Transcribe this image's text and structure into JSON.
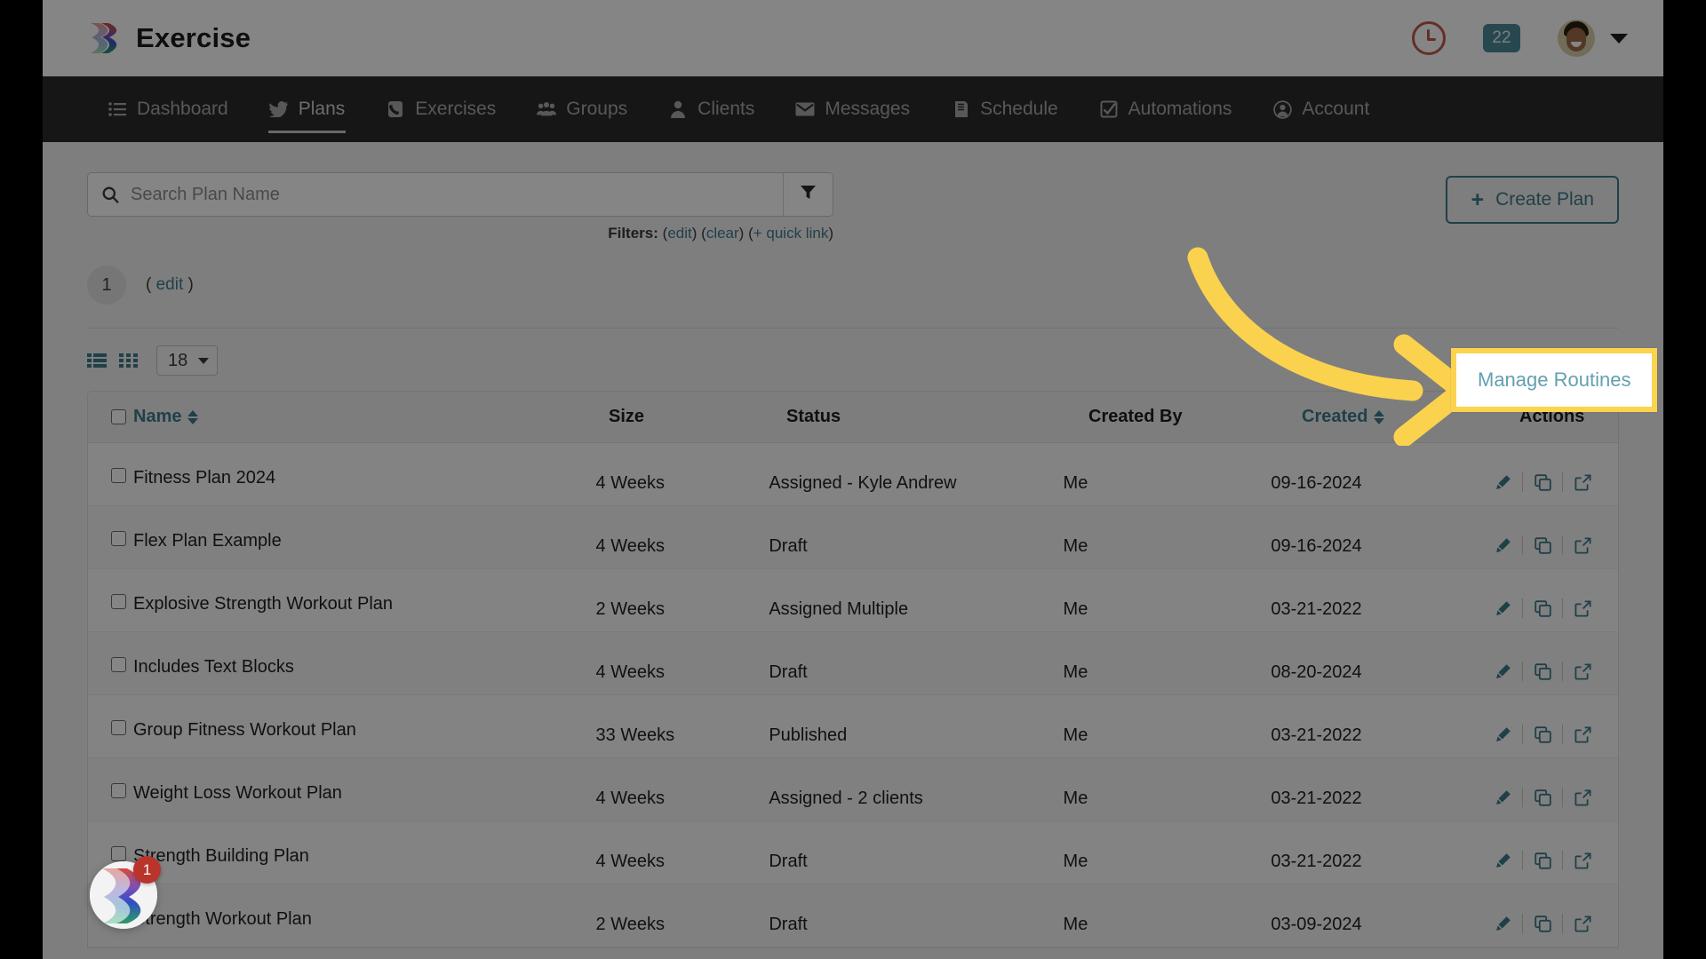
{
  "header": {
    "brand_name": "Exercise",
    "logo_icon": "exercise-waves-logo",
    "clock_icon": "clock-icon",
    "notification_count": "22",
    "avatar_icon": "user-avatar",
    "chevron_icon": "chevron-down-icon"
  },
  "nav": {
    "items": [
      {
        "label": "Dashboard",
        "icon": "list-icon",
        "active": false
      },
      {
        "label": "Plans",
        "icon": "bird-icon",
        "active": true
      },
      {
        "label": "Exercises",
        "icon": "phone-icon",
        "active": false
      },
      {
        "label": "Groups",
        "icon": "people-icon",
        "active": false
      },
      {
        "label": "Clients",
        "icon": "person-icon",
        "active": false
      },
      {
        "label": "Messages",
        "icon": "envelope-icon",
        "active": false
      },
      {
        "label": "Schedule",
        "icon": "book-icon",
        "active": false
      },
      {
        "label": "Automations",
        "icon": "check-square-icon",
        "active": false
      },
      {
        "label": "Account",
        "icon": "user-circle-icon",
        "active": false
      }
    ]
  },
  "toolbar": {
    "search_placeholder": "Search Plan Name",
    "search_value": "",
    "search_icon": "search-icon",
    "filter_icon": "funnel-icon",
    "create_plan_label": "Create Plan",
    "create_plan_plus": "+",
    "filters_label": "Filters:",
    "filters_edit": "edit",
    "filters_clear": "clear",
    "filters_quick_link": "+ quick link",
    "paren_open": "(",
    "paren_close": ")"
  },
  "page_count": {
    "value": "1",
    "edit_label": "edit",
    "edit_prefix": "( ",
    "edit_suffix": " )"
  },
  "view_controls": {
    "list_view_icon": "list-view-icon",
    "grid_view_icon": "grid-view-icon",
    "per_page_value": "18",
    "manage_routines_label": "Manage Routines"
  },
  "table": {
    "columns": [
      {
        "key": "name",
        "label": "Name",
        "sortable": true
      },
      {
        "key": "size",
        "label": "Size",
        "sortable": false
      },
      {
        "key": "status",
        "label": "Status",
        "sortable": false
      },
      {
        "key": "by",
        "label": "Created By",
        "sortable": false
      },
      {
        "key": "created",
        "label": "Created",
        "sortable": true
      },
      {
        "key": "actions",
        "label": "Actions",
        "sortable": false
      }
    ],
    "action_icons": [
      "pencil-icon",
      "copy-icon",
      "external-link-icon"
    ],
    "rows": [
      {
        "name": "Fitness Plan 2024",
        "size": "4 Weeks",
        "status": "Assigned - Kyle Andrew",
        "by": "Me",
        "created": "09-16-2024"
      },
      {
        "name": "Flex Plan Example",
        "size": "4 Weeks",
        "status": "Draft",
        "by": "Me",
        "created": "09-16-2024"
      },
      {
        "name": "Explosive Strength Workout Plan",
        "size": "2 Weeks",
        "status": "Assigned Multiple",
        "by": "Me",
        "created": "03-21-2022"
      },
      {
        "name": "Includes Text Blocks",
        "size": "4 Weeks",
        "status": "Draft",
        "by": "Me",
        "created": "08-20-2024"
      },
      {
        "name": "Group Fitness Workout Plan",
        "size": "33 Weeks",
        "status": "Published",
        "by": "Me",
        "created": "03-21-2022"
      },
      {
        "name": "Weight Loss Workout Plan",
        "size": "4 Weeks",
        "status": "Assigned - 2 clients",
        "by": "Me",
        "created": "03-21-2022"
      },
      {
        "name": "Strength Building Plan",
        "size": "4 Weeks",
        "status": "Draft",
        "by": "Me",
        "created": "03-21-2022"
      },
      {
        "name": "Strength Workout Plan",
        "size": "2 Weeks",
        "status": "Draft",
        "by": "Me",
        "created": "03-09-2024"
      }
    ]
  },
  "chat_widget": {
    "badge_count": "1",
    "icon": "chat-launcher-icon"
  },
  "annotation": {
    "arrow_icon": "curved-arrow-right",
    "arrow_color": "#fbd24e",
    "highlight_color": "#fcd34e"
  },
  "colors": {
    "accent_teal": "#3e7c8c",
    "nav_bg": "#2b2b2b",
    "badge_teal": "#4d8a99",
    "clock_red": "#c0584a"
  }
}
